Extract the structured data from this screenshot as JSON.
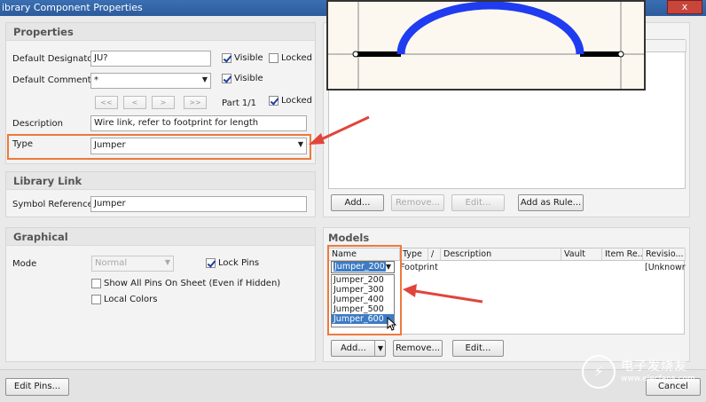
{
  "window": {
    "title": "ibrary Component Properties",
    "close_label": "x"
  },
  "properties": {
    "header": "Properties",
    "designator_label": "Default Designator",
    "designator_value": "JU?",
    "comment_label": "Default Comment",
    "comment_value": "*",
    "visible_label": "Visible",
    "locked_label": "Locked",
    "visible_comment_label": "Visible",
    "nav": [
      "<<",
      "<",
      ">",
      ">>"
    ],
    "part_label": "Part 1/1",
    "part_locked_label": "Locked",
    "description_label": "Description",
    "description_value": "Wire link, refer to footprint for length",
    "type_label": "Type",
    "type_value": "Jumper"
  },
  "library_link": {
    "header": "Library Link",
    "symbol_ref_label": "Symbol Reference",
    "symbol_ref_value": "Jumper"
  },
  "graphical": {
    "header": "Graphical",
    "mode_label": "Mode",
    "mode_value": "Normal",
    "lock_pins_label": "Lock Pins",
    "show_all_pins_label": "Show All Pins On Sheet (Even if Hidden)",
    "local_colors_label": "Local Colors"
  },
  "parameters": {
    "add": "Add...",
    "remove": "Remove...",
    "edit": "Edit...",
    "add_rule": "Add as Rule..."
  },
  "models": {
    "header": "Models",
    "columns": [
      "Name",
      "Type",
      "/",
      "Description",
      "Vault",
      "Item Re...",
      "Revisio..."
    ],
    "row": {
      "name": "Jumper_200",
      "type": "Footprint",
      "revision": "[Unknowr"
    },
    "options": [
      "Jumper_200",
      "Jumper_300",
      "Jumper_400",
      "Jumper_500",
      "Jumper_600"
    ],
    "selected_option": "Jumper_600",
    "add": "Add...",
    "remove": "Remove...",
    "edit": "Edit..."
  },
  "footer": {
    "edit_pins": "Edit Pins...",
    "cancel": "Cancel"
  },
  "watermark": {
    "text": "电子发烧友",
    "site": "www.elecfans.com"
  },
  "colors": {
    "highlight": "#ec7a3d",
    "arrow": "#e0453c",
    "selection": "#3d7bc4",
    "title_bar": "#2c5b9c",
    "preview_arc": "#1f3cf0"
  }
}
